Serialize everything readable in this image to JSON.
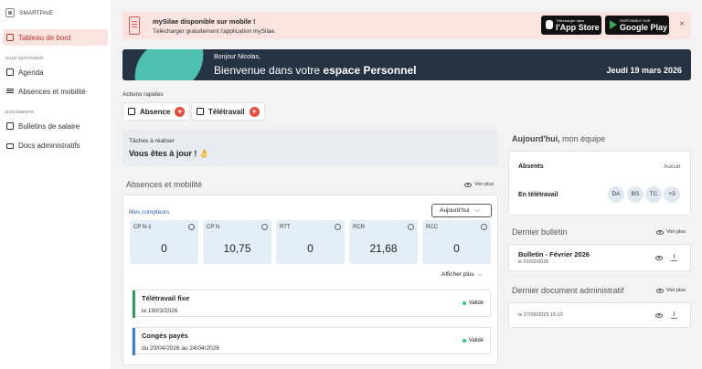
{
  "sidebar": {
    "brand": "SMARTPAIE",
    "active_item": "Tableau de bord",
    "sections": [
      {
        "label": "SUIVI QUOTIDIEN",
        "items": [
          "Agenda",
          "Absences et mobilité"
        ]
      },
      {
        "label": "DOCUMENTS",
        "items": [
          "Bulletins de salaire",
          "Docs administratifs"
        ]
      }
    ]
  },
  "banner": {
    "title": "mySilae disponible sur mobile !",
    "subtitle": "Télécharger gratuitement l'application mySilae.",
    "appstore_small": "Télécharger dans",
    "appstore_label": "l'App Store",
    "googleplay_small": "DISPONIBLE SUR",
    "googleplay_label": "Google Play",
    "close": "×"
  },
  "hero": {
    "greeting": "Bonjour Nicolas,",
    "title_prefix": "Bienvenue dans votre",
    "title_strong": "espace Personnel",
    "date": "Jeudi 19 mars 2026"
  },
  "quick_actions": {
    "label": "Actions rapides",
    "items": [
      "Absence",
      "Télétravail"
    ]
  },
  "tasks": {
    "label": "Tâches à réaliser",
    "value": "Vous êtes à jour ! 👌"
  },
  "absences": {
    "title": "Absences et mobilité",
    "see_more": "Voir plus",
    "counters_label": "Mes compteurs",
    "period_select": "Aujourd'hui",
    "counters": [
      {
        "label": "CP N-1",
        "value": "0"
      },
      {
        "label": "CP N",
        "value": "10,75"
      },
      {
        "label": "RTT",
        "value": "0"
      },
      {
        "label": "RCR",
        "value": "21,68"
      },
      {
        "label": "RCC",
        "value": "0"
      }
    ],
    "show_more": "Afficher plus",
    "requests": [
      {
        "title": "Télétravail fixe",
        "date": "le 19/03/2026",
        "status": "Validé",
        "color": "#2e9e57"
      },
      {
        "title": "Congés payés",
        "date": "du 20/04/2026 au 24/04/2026",
        "status": "Validé",
        "color": "#3b7ddd"
      }
    ]
  },
  "team": {
    "title": "Aujourd'hui,",
    "title_suffix": "mon équipe",
    "absents_label": "Absents",
    "absents_value": "Aucun",
    "remote_label": "En télétravail",
    "remote_people": [
      "DA",
      "BS",
      "TC",
      "+3"
    ]
  },
  "last_payslip": {
    "title": "Dernier bulletin",
    "see_more": "Voir plus",
    "name": "Bulletin - Février 2026",
    "date": "le 01/02/2026"
  },
  "last_doc": {
    "title": "Dernier document administratif",
    "see_more": "Voir plus",
    "date": "le 27/09/2023 15:10"
  },
  "colors": {
    "accent": "#e74c3c",
    "active_bg": "#fbe3df",
    "hero_bg": "#263342",
    "counter_bg": "#e4eef9"
  }
}
